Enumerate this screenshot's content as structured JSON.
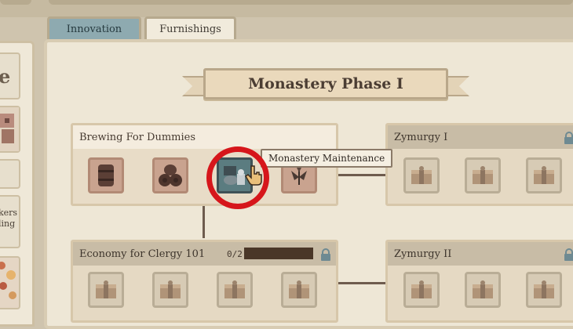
{
  "tabs": [
    {
      "label": "Innovation",
      "active": true
    },
    {
      "label": "Furnishings",
      "active": false
    }
  ],
  "sidebar": {
    "letter": "e",
    "text_line1": "kers",
    "text_line2": "ling"
  },
  "banner": {
    "title": "Monastery Phase I"
  },
  "tooltip": {
    "text": "Monastery Maintenance"
  },
  "cards": [
    {
      "title": "Brewing For Dummies",
      "locked": false,
      "slots": [
        "barrel-icon",
        "barrels-icon",
        "maintenance-kit-icon",
        "herbs-icon"
      ]
    },
    {
      "title": "Zymurgy I",
      "locked": true,
      "slots": [
        "crate-icon",
        "crate-icon",
        "crate-icon"
      ]
    },
    {
      "title": "Economy for Clergy 101",
      "locked": true,
      "progress": "0/2",
      "progress_value": 0,
      "slots": [
        "crate-icon",
        "crate-icon",
        "crate-icon",
        "crate-icon"
      ]
    },
    {
      "title": "Zymurgy II",
      "locked": true,
      "slots": [
        "crate-icon",
        "crate-icon",
        "crate-icon"
      ]
    }
  ],
  "colors": {
    "active_tab": "#8eaab0",
    "highlight": "#d6161b",
    "progress_bar": "#4a3728"
  }
}
